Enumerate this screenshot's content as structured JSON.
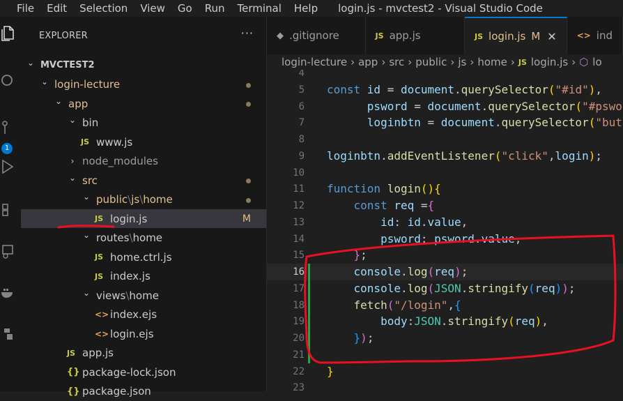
{
  "menu": [
    "File",
    "Edit",
    "Selection",
    "View",
    "Go",
    "Run",
    "Terminal",
    "Help"
  ],
  "window_title": "login.js - mvctest2 - Visual Studio Code",
  "activity": {
    "source_control_badge": "1"
  },
  "explorer": {
    "header": "EXPLORER",
    "more": "···",
    "tree": [
      {
        "label": "MVCTEST2",
        "depth": 0,
        "kind": "folder",
        "open": true,
        "bold": true
      },
      {
        "label": "login-lecture",
        "depth": 1,
        "kind": "folder",
        "open": true,
        "highlight": true,
        "dot": true
      },
      {
        "label": "app",
        "depth": 2,
        "kind": "folder",
        "open": true,
        "highlight": true,
        "dot": true
      },
      {
        "label": "bin",
        "depth": 3,
        "kind": "folder",
        "open": true
      },
      {
        "label": "www.js",
        "depth": 4,
        "kind": "js"
      },
      {
        "label": "node_modules",
        "depth": 3,
        "kind": "folder",
        "open": false,
        "dim": true
      },
      {
        "label": "src",
        "depth": 3,
        "kind": "folder",
        "open": true,
        "highlight": true,
        "dot": true
      },
      {
        "label": "public",
        "label2": "js",
        "label3": "home",
        "depth": 4,
        "kind": "folder",
        "open": true,
        "highlight": true,
        "dot": true
      },
      {
        "label": "login.js",
        "depth": 5,
        "kind": "js",
        "selected": true,
        "modified": "M"
      },
      {
        "label": "routes",
        "label2": "home",
        "depth": 4,
        "kind": "folder",
        "open": true
      },
      {
        "label": "home.ctrl.js",
        "depth": 5,
        "kind": "js"
      },
      {
        "label": "index.js",
        "depth": 5,
        "kind": "js"
      },
      {
        "label": "views",
        "label2": "home",
        "depth": 4,
        "kind": "folder",
        "open": true
      },
      {
        "label": "index.ejs",
        "depth": 5,
        "kind": "ejs"
      },
      {
        "label": "login.ejs",
        "depth": 5,
        "kind": "ejs"
      },
      {
        "label": "app.js",
        "depth": 3,
        "kind": "js"
      },
      {
        "label": "package-lock.json",
        "depth": 3,
        "kind": "json"
      },
      {
        "label": "package.json",
        "depth": 3,
        "kind": "json"
      }
    ]
  },
  "tabs": [
    {
      "label": ".gitignore",
      "icon": "git"
    },
    {
      "label": "app.js",
      "icon": "js"
    },
    {
      "label": "login.js",
      "icon": "js",
      "active": true,
      "modified": "M",
      "close": "✕"
    },
    {
      "label": "ind",
      "icon": "tag"
    }
  ],
  "breadcrumb": [
    "login-lecture",
    "app",
    "src",
    "public",
    "js",
    "home",
    "login.js",
    "lo"
  ],
  "editor": {
    "current_line": 16,
    "git_added_lines": [
      16,
      17,
      18,
      19,
      20,
      21
    ],
    "lines": [
      {
        "n": "4",
        "tokens": []
      },
      {
        "n": "5",
        "tokens": [
          [
            "k",
            "const "
          ],
          [
            "v",
            "id"
          ],
          [
            "",
            ""
          ],
          [
            "",
            " = "
          ],
          [
            "v",
            "document"
          ],
          [
            "",
            "."
          ],
          [
            "f",
            "querySelector"
          ],
          [
            "p1",
            "("
          ],
          [
            "s",
            "\"#id\""
          ],
          [
            "p1",
            ")"
          ],
          [
            "",
            ","
          ]
        ]
      },
      {
        "n": "6",
        "tokens": [
          [
            "",
            "      "
          ],
          [
            "v",
            "psword"
          ],
          [
            "",
            " = "
          ],
          [
            "v",
            "document"
          ],
          [
            "",
            "."
          ],
          [
            "f",
            "querySelector"
          ],
          [
            "p1",
            "("
          ],
          [
            "s",
            "\"#psword\""
          ]
        ]
      },
      {
        "n": "7",
        "tokens": [
          [
            "",
            "      "
          ],
          [
            "v",
            "loginbtn"
          ],
          [
            "",
            " = "
          ],
          [
            "v",
            "document"
          ],
          [
            "",
            "."
          ],
          [
            "f",
            "querySelector"
          ],
          [
            "p1",
            "("
          ],
          [
            "s",
            "\"button\""
          ]
        ]
      },
      {
        "n": "8",
        "tokens": []
      },
      {
        "n": "9",
        "tokens": [
          [
            "v",
            "loginbtn"
          ],
          [
            "",
            "."
          ],
          [
            "f",
            "addEventListener"
          ],
          [
            "p1",
            "("
          ],
          [
            "s",
            "\"click\""
          ],
          [
            "",
            ","
          ],
          [
            "v",
            "login"
          ],
          [
            "p1",
            ")"
          ],
          [
            "",
            ";"
          ]
        ]
      },
      {
        "n": "10",
        "tokens": []
      },
      {
        "n": "11",
        "tokens": [
          [
            "k",
            "function "
          ],
          [
            "f",
            "login"
          ],
          [
            "p1",
            "()"
          ],
          [
            "p1",
            "{"
          ]
        ]
      },
      {
        "n": "12",
        "tokens": [
          [
            "",
            "    "
          ],
          [
            "k",
            "const "
          ],
          [
            "v",
            "req"
          ],
          [
            "",
            " ="
          ],
          [
            "p2",
            "{"
          ]
        ]
      },
      {
        "n": "13",
        "tokens": [
          [
            "",
            "        "
          ],
          [
            "v",
            "id"
          ],
          [
            "",
            ": "
          ],
          [
            "v",
            "id"
          ],
          [
            "",
            "."
          ],
          [
            "v",
            "value"
          ],
          [
            "",
            ","
          ]
        ]
      },
      {
        "n": "14",
        "tokens": [
          [
            "",
            "        "
          ],
          [
            "v",
            "psword"
          ],
          [
            "",
            ": "
          ],
          [
            "v",
            "psword"
          ],
          [
            "",
            "."
          ],
          [
            "v",
            "value"
          ],
          [
            "",
            ","
          ]
        ]
      },
      {
        "n": "15",
        "tokens": [
          [
            "",
            "    "
          ],
          [
            "p2",
            "}"
          ],
          [
            "",
            ";"
          ]
        ]
      },
      {
        "n": "16",
        "tokens": [
          [
            "",
            "    "
          ],
          [
            "v",
            "console"
          ],
          [
            "",
            "."
          ],
          [
            "f",
            "log"
          ],
          [
            "p2",
            "("
          ],
          [
            "v",
            "req"
          ],
          [
            "p2",
            ")"
          ],
          [
            "",
            ";"
          ]
        ]
      },
      {
        "n": "17",
        "tokens": [
          [
            "",
            "    "
          ],
          [
            "v",
            "console"
          ],
          [
            "",
            "."
          ],
          [
            "f",
            "log"
          ],
          [
            "p2",
            "("
          ],
          [
            "c",
            "JSON"
          ],
          [
            "",
            "."
          ],
          [
            "f",
            "stringify"
          ],
          [
            "p3",
            "("
          ],
          [
            "v",
            "req"
          ],
          [
            "p3",
            ")"
          ],
          [
            "p2",
            ")"
          ],
          [
            "",
            ";"
          ]
        ]
      },
      {
        "n": "18",
        "tokens": [
          [
            "",
            "    "
          ],
          [
            "f",
            "fetch"
          ],
          [
            "p2",
            "("
          ],
          [
            "s",
            "\"/login\""
          ],
          [
            "",
            ","
          ],
          [
            "p3",
            "{"
          ]
        ]
      },
      {
        "n": "19",
        "tokens": [
          [
            "",
            "        "
          ],
          [
            "v",
            "body"
          ],
          [
            "",
            ":"
          ],
          [
            "c",
            "JSON"
          ],
          [
            "",
            "."
          ],
          [
            "f",
            "stringify"
          ],
          [
            "p1",
            "("
          ],
          [
            "v",
            "req"
          ],
          [
            "p1",
            ")"
          ],
          [
            "",
            ","
          ]
        ]
      },
      {
        "n": "20",
        "tokens": [
          [
            "",
            "    "
          ],
          [
            "p3",
            "}"
          ],
          [
            "p2",
            ")"
          ],
          [
            "",
            ";"
          ]
        ]
      },
      {
        "n": "21",
        "tokens": []
      },
      {
        "n": "22",
        "tokens": [
          [
            "p1",
            "}"
          ]
        ]
      },
      {
        "n": "23",
        "tokens": []
      }
    ]
  },
  "annotation_color": "#e81123"
}
